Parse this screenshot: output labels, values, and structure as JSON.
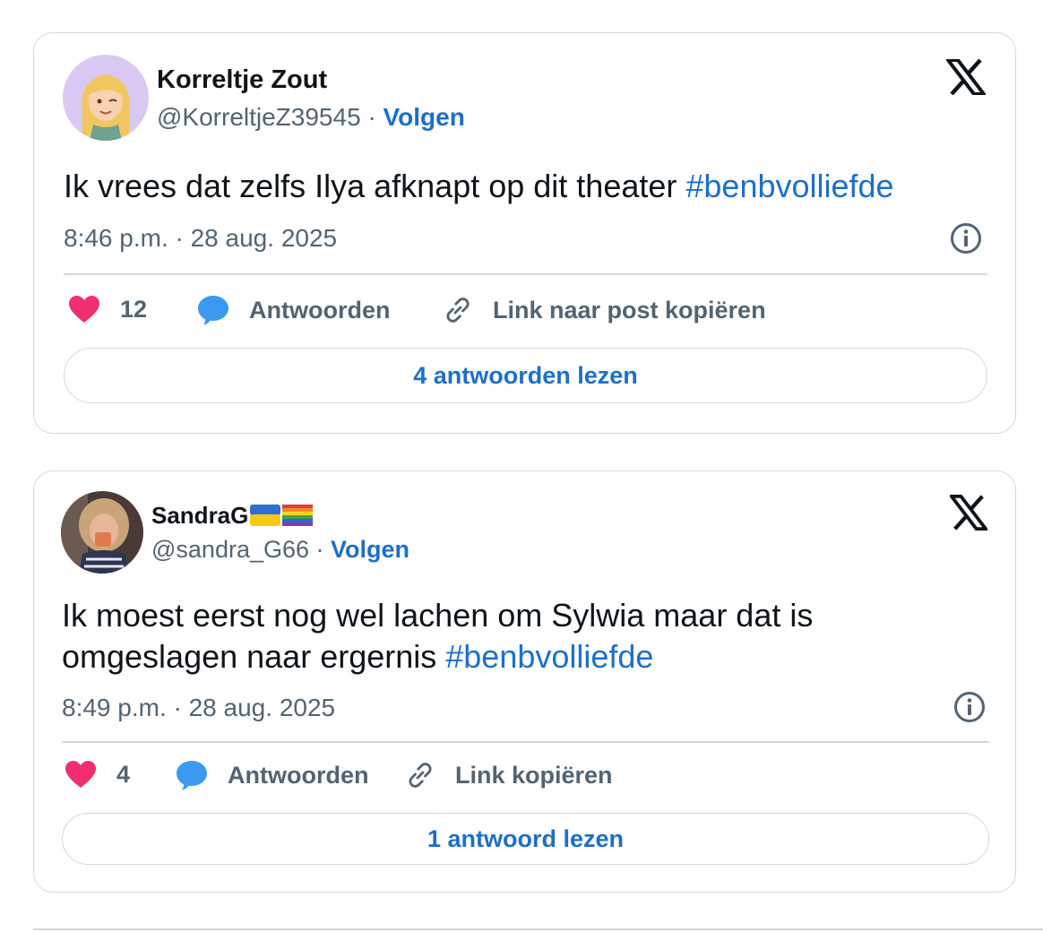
{
  "tweets": [
    {
      "author_name": "Korreltje Zout",
      "handle": "@KorreltjeZ39545",
      "separator": "·",
      "follow_label": "Volgen",
      "text": "Ik vrees dat zelfs Ilya afknapt op dit theater ",
      "hashtag": "#benbvolliefde",
      "timestamp": "8:46 p.m. · 28 aug. 2025",
      "like_count": "12",
      "reply_label": "Antwoorden",
      "link_label": "Link naar post kopiëren",
      "read_replies_label": "4 antwoorden lezen"
    },
    {
      "author_name": "SandraG",
      "handle": "@sandra_G66",
      "separator": "·",
      "follow_label": "Volgen",
      "text_line1": "Ik moest eerst nog wel lachen om Sylwia maar dat is",
      "text_line2": "omgeslagen naar ergernis ",
      "hashtag": "#benbvolliefde",
      "timestamp": "8:49 p.m. · 28 aug. 2025",
      "like_count": "4",
      "reply_label": "Antwoorden",
      "link_label": "Link kopiëren",
      "read_replies_label": "1 antwoord lezen",
      "name_emojis": [
        "ukraine-flag",
        "rainbow-flag"
      ]
    }
  ],
  "colors": {
    "accent": "#1d6fc9",
    "like": "#f0306d",
    "reply": "#3b9af0",
    "muted": "#536471",
    "border": "#cfd9de"
  }
}
